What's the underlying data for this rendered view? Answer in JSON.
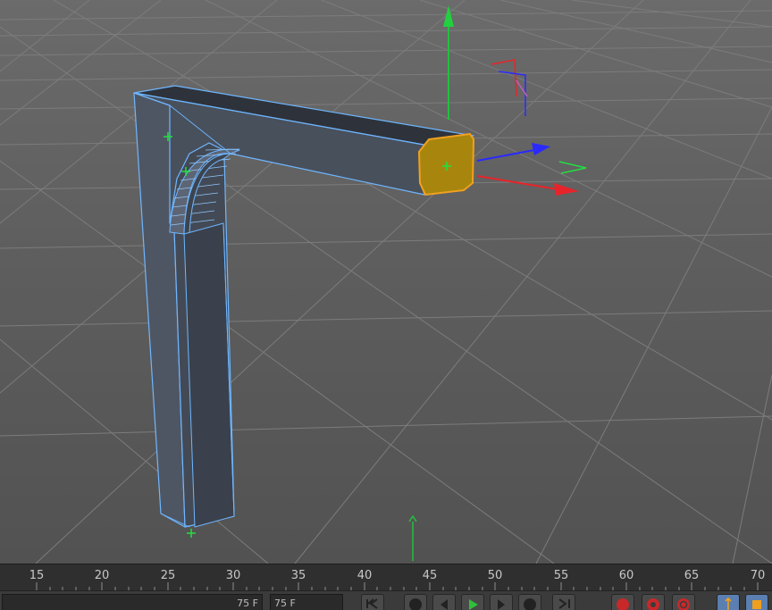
{
  "viewport": {
    "grid_color": "#7a7a7a",
    "wire_color": "#6fb6ff",
    "selection_color": "#f0a020",
    "axis_colors": {
      "x": "#e8242a",
      "y": "#22c040",
      "z": "#2a2aff"
    }
  },
  "timeline": {
    "tick_labels": [
      "15",
      "20",
      "25",
      "30",
      "35",
      "40",
      "45",
      "50",
      "55",
      "60",
      "65",
      "70"
    ],
    "current_frame_color": "#22c040"
  },
  "transport": {
    "start_field": "75 F",
    "end_field": "75 F",
    "buttons": [
      "go-to-start-icon",
      "previous-keyframe-icon",
      "previous-frame-icon",
      "play-icon",
      "next-frame-icon",
      "next-keyframe-icon",
      "go-to-end-icon",
      "record-active-objects-icon",
      "autokeying-icon",
      "keyframe-selection-icon",
      "move-tool-icon",
      "scale-tool-icon"
    ]
  }
}
